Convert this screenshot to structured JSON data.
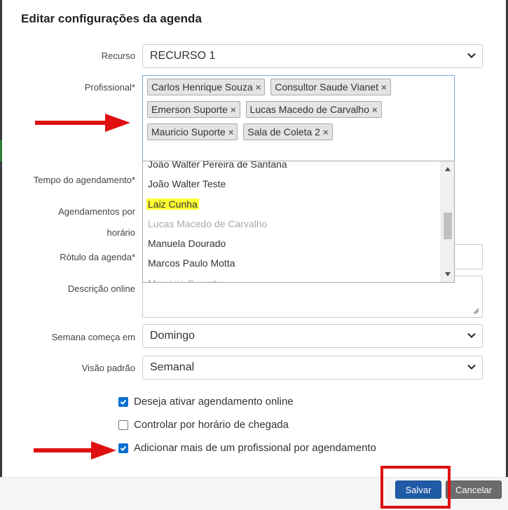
{
  "dialog": {
    "title": "Editar configurações da agenda"
  },
  "fields": {
    "recurso": {
      "label": "Recurso",
      "value": "RECURSO 1"
    },
    "profissional": {
      "label": "Profissional*",
      "selected_tags": [
        "Carlos Henrique Souza",
        "Consultor Saude Vianet",
        "Emerson Suporte",
        "Lucas Macedo de Carvalho",
        "Mauricio Suporte",
        "Sala de Coleta 2"
      ],
      "options": [
        "João Walter Pereira de Santana",
        "João Walter Teste",
        "Laiz Cunha",
        "Lucas Macedo de Carvalho",
        "Manuela Dourado",
        "Marcos Paulo Motta",
        "Mauricio Suporte"
      ]
    },
    "tempo": {
      "label": "Tempo do agendamento*"
    },
    "agendamentos": {
      "label": "Agendamentos por horário"
    },
    "rotulo": {
      "label": "Rótulo da agenda*"
    },
    "descricao": {
      "label": "Descrição online"
    },
    "semana": {
      "label": "Semana começa em",
      "value": "Domingo"
    },
    "visao": {
      "label": "Visão padrão",
      "value": "Semanal"
    }
  },
  "checkboxes": [
    {
      "label": "Deseja ativar agendamento online",
      "checked": true
    },
    {
      "label": "Controlar por horário de chegada",
      "checked": false
    },
    {
      "label": "Adicionar mais de um profissional por agendamento",
      "checked": true
    }
  ],
  "buttons": {
    "save": "Salvar",
    "cancel": "Cancelar"
  },
  "colors": {
    "annotation_red": "#e01010",
    "highlight_yellow": "#ffff33",
    "primary_blue": "#1f5aa6",
    "checkbox_blue": "#0b6fd1"
  },
  "icons": {
    "tag_remove": "×",
    "select_chevron": "chevron-down-icon"
  }
}
